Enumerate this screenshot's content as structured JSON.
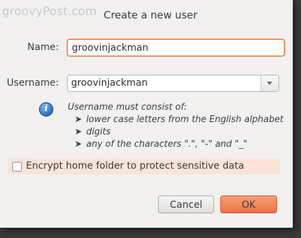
{
  "watermark": "groovyPost.com",
  "dialog": {
    "title": "Create a new user"
  },
  "form": {
    "name_label": "Name:",
    "name_value": "groovinjackman",
    "username_label": "Username:",
    "username_value": "groovinjackman"
  },
  "hint": {
    "icon": "info-icon",
    "heading": "Username must consist of:",
    "bullet": "➤",
    "items": [
      "lower case letters from the English alphabet",
      "digits",
      "any of the characters \".\", \"-\" and \"_\""
    ]
  },
  "encrypt": {
    "label": "Encrypt home folder to protect sensitive data",
    "checked": false
  },
  "buttons": {
    "cancel_label": "Cancel",
    "ok_label": "OK"
  },
  "colors": {
    "accent": "#ee7144",
    "focus_border": "#e8743b",
    "highlight_row": "#fbe3d6",
    "info_blue": "#3a7dc6"
  }
}
